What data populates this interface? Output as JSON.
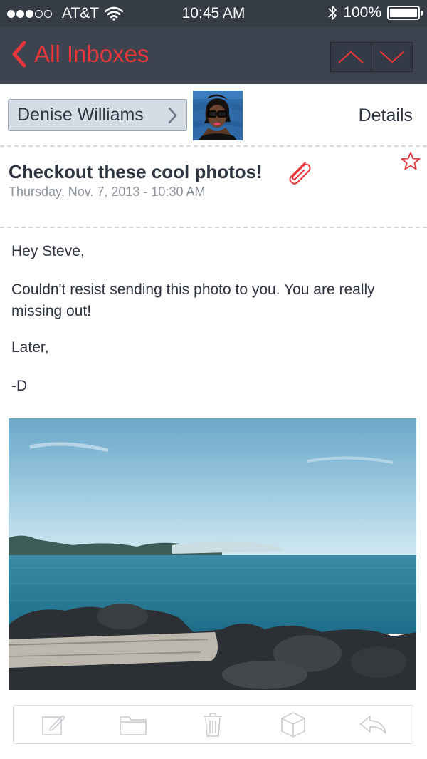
{
  "status_bar": {
    "carrier": "AT&T",
    "time": "10:45 AM",
    "battery": "100%",
    "battery_level": 1.0,
    "signal_filled": 3,
    "signal_total": 5
  },
  "nav": {
    "back_label": "All Inboxes",
    "accent_color": "#e8363a"
  },
  "header": {
    "sender_name": "Denise Williams",
    "details_label": "Details"
  },
  "message": {
    "subject": "Checkout these cool photos!",
    "date": "Thursday, Nov. 7, 2013 - 10:30 AM",
    "has_attachment": true,
    "starred": false,
    "body": {
      "greeting": "Hey Steve,",
      "paragraph": "Couldn't resist sending this photo to you.  You are really missing out!",
      "closing": "Later,",
      "signature": "-D"
    }
  },
  "toolbar": {
    "icons": [
      "compose-icon",
      "folder-icon",
      "trash-icon",
      "archive-box-icon",
      "reply-icon"
    ]
  }
}
